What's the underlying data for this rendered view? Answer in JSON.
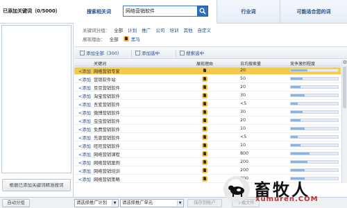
{
  "left_panel": {
    "title": "已添加关键词（0/5000）",
    "precise_button": "根据已添加关键词精准搜词"
  },
  "tabs": {
    "search_label": "搜索相关词",
    "search_value": "网络营销软件",
    "industry_label": "行业词",
    "suitable_label": "可能适合您的词"
  },
  "filters": {
    "group_label": "关键词分组：",
    "group_options": [
      "全部",
      "计划",
      "推广",
      "公司",
      "培训",
      "其他",
      "自定义"
    ],
    "reason_label": "展现理由：",
    "reason_options": [
      "全部",
      "黑马"
    ]
  },
  "toolbar": {
    "add_all": "添加全部（300）",
    "add_selected": "添加选中",
    "search_selected": "搜索选中"
  },
  "table": {
    "headers": [
      "关键词",
      "展现理由",
      "日均搜索量",
      "竞争激烈程度"
    ],
    "add_label": "<添加",
    "rows": [
      {
        "keyword": "网络营销专家",
        "volume": "20",
        "competition": 0.35,
        "highlight": true
      },
      {
        "keyword": "营销软件站",
        "volume": "50",
        "competition": 0.25,
        "highlight": false
      },
      {
        "keyword": "豆豆营销软件",
        "volume": "20",
        "competition": 0.2,
        "highlight": false
      },
      {
        "keyword": "淘宝营销软件",
        "volume": "30",
        "competition": 0.3,
        "highlight": false
      },
      {
        "keyword": "吾爱营销软件",
        "volume": "<5",
        "competition": 0.15,
        "highlight": false
      },
      {
        "keyword": "微博营销软件",
        "volume": "30",
        "competition": 0.25,
        "highlight": false
      },
      {
        "keyword": "虫虫营销软件",
        "volume": "20",
        "competition": 0.2,
        "highlight": false
      },
      {
        "keyword": "免费营销软件",
        "volume": "10",
        "competition": 0.3,
        "highlight": false
      },
      {
        "keyword": "先驱营销软件",
        "volume": "<5",
        "competition": 0.15,
        "highlight": false
      },
      {
        "keyword": "旺旺营销软件",
        "volume": "10",
        "competition": 0.2,
        "highlight": false
      },
      {
        "keyword": "网络营销课程",
        "volume": "800",
        "competition": 0.4,
        "highlight": false
      },
      {
        "keyword": "网络营销案例",
        "volume": "200",
        "competition": 0.35,
        "highlight": false
      },
      {
        "keyword": "网络营销培训",
        "volume": "200",
        "competition": 0.3,
        "highlight": false
      },
      {
        "keyword": "网络营销策略",
        "volume": "200",
        "competition": 0.3,
        "highlight": false
      }
    ]
  },
  "bottom": {
    "auto_group": "自动分组",
    "plan_select": "请选择推广计划",
    "unit_select": "请选择推广单元",
    "save_button": "保存到账户",
    "export_button": "下载文件"
  },
  "watermark": {
    "text": "畜牧人",
    "url": "xumuren.COM"
  },
  "colors": {
    "highlight": "#f5c94a",
    "link": "#1f4e8f",
    "accent": "#2e6fc0"
  }
}
